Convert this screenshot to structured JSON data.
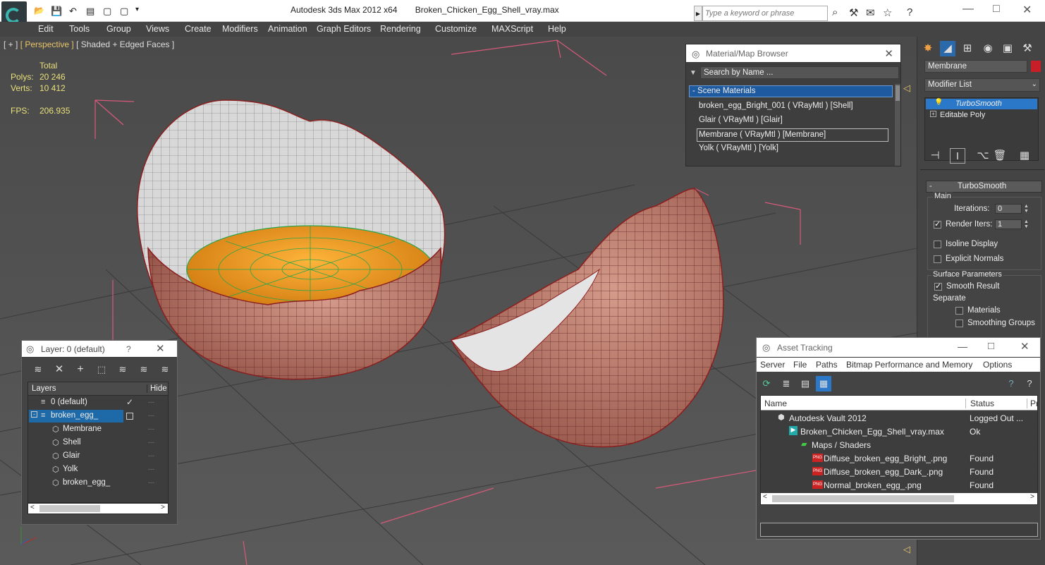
{
  "app": {
    "title": "Autodesk 3ds Max  2012 x64",
    "file": "Broken_Chicken_Egg_Shell_vray.max",
    "search_placeholder": "Type a keyword or phrase"
  },
  "menu": [
    "Edit",
    "Tools",
    "Group",
    "Views",
    "Create",
    "Modifiers",
    "Animation",
    "Graph Editors",
    "Rendering",
    "Customize",
    "MAXScript",
    "Help"
  ],
  "viewport": {
    "label_plus": "[ + ]",
    "label_view": "[ Perspective ]",
    "label_shading": "[ Shaded + Edged Faces ]",
    "total_label": "Total",
    "polys_label": "Polys:",
    "polys_value": "20 246",
    "verts_label": "Verts:",
    "verts_value": "10 412",
    "fps_label": "FPS:",
    "fps_value": "206.935"
  },
  "material_browser": {
    "title": "Material/Map Browser",
    "search_placeholder": "Search by Name ...",
    "section": "- Scene Materials",
    "items": [
      "broken_egg_Bright_001  ( VRayMtl )  [Shell]",
      "Glair  ( VRayMtl )  [Glair]",
      "Membrane  ( VRayMtl )  [Membrane]",
      "Yolk  ( VRayMtl )  [Yolk]"
    ]
  },
  "command_panel": {
    "object_name": "Membrane",
    "modifier_list": "Modifier List",
    "stack": [
      "TurboSmooth",
      "Editable Poly"
    ],
    "rollout_title": "TurboSmooth",
    "main_group": "Main",
    "iterations_label": "Iterations:",
    "iterations_value": "0",
    "render_iters_label": "Render Iters:",
    "render_iters_value": "1",
    "isoline": "Isoline Display",
    "explicit_normals": "Explicit Normals",
    "surface_params": "Surface Parameters",
    "smooth_result": "Smooth Result",
    "separate": "Separate",
    "materials": "Materials",
    "smoothing_groups": "Smoothing Groups"
  },
  "layer_window": {
    "title": "Layer: 0 (default)",
    "help": "?",
    "col_layers": "Layers",
    "col_hide": "Hide",
    "rows": [
      "0 (default)",
      "broken_egg_",
      "Membrane",
      "Shell",
      "Glair",
      "Yolk",
      "broken_egg_"
    ]
  },
  "asset_tracking": {
    "title": "Asset Tracking",
    "menu": [
      "Server",
      "File",
      "Paths",
      "Bitmap Performance and Memory",
      "Options"
    ],
    "col_name": "Name",
    "col_status": "Status",
    "col_extra": "Pr",
    "rows": [
      {
        "name": "Autodesk Vault 2012",
        "status": "Logged Out ..."
      },
      {
        "name": "Broken_Chicken_Egg_Shell_vray.max",
        "status": "Ok"
      },
      {
        "name": "Maps / Shaders",
        "status": ""
      },
      {
        "name": "Diffuse_broken_egg_Bright_.png",
        "status": "Found"
      },
      {
        "name": "Diffuse_broken_egg_Dark_.png",
        "status": "Found"
      },
      {
        "name": "Normal_broken_egg_.png",
        "status": "Found"
      }
    ]
  },
  "colors": {
    "accent": "#1e6aa8",
    "stats": "#e9e07b",
    "shell": "#b0685a",
    "yolk": "#f0a020",
    "grid": "#e05070"
  }
}
